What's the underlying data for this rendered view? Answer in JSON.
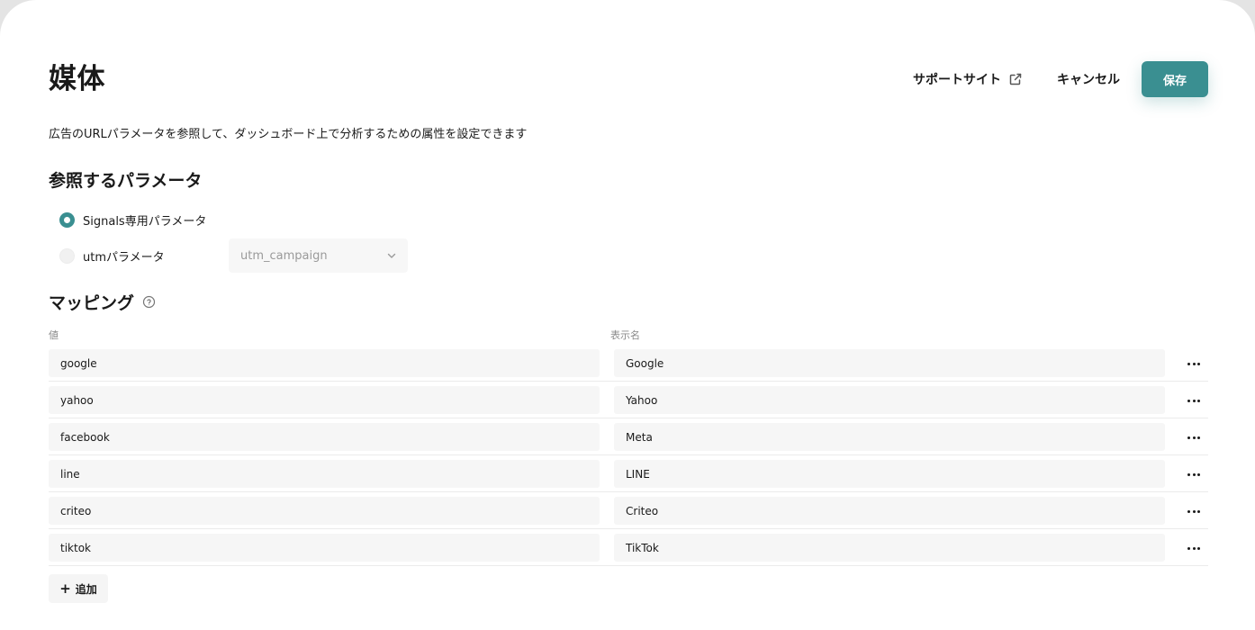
{
  "page": {
    "title": "媒体",
    "description": "広告のURLパラメータを参照して、ダッシュボード上で分析するための属性を設定できます"
  },
  "header": {
    "support_label": "サポートサイト",
    "support_icon": "external-link-icon",
    "cancel_label": "キャンセル",
    "save_label": "保存"
  },
  "params": {
    "title": "参照するパラメータ",
    "options": [
      {
        "label": "Signals専用パラメータ",
        "selected": true
      },
      {
        "label": "utmパラメータ",
        "selected": false
      }
    ],
    "select_value": "utm_campaign"
  },
  "mapping": {
    "title": "マッピング",
    "help_icon": "help-circle-icon",
    "columns": {
      "value": "値",
      "display": "表示名"
    },
    "rows": [
      {
        "value": "google",
        "display": "Google"
      },
      {
        "value": "yahoo",
        "display": "Yahoo"
      },
      {
        "value": "facebook",
        "display": "Meta"
      },
      {
        "value": "line",
        "display": "LINE"
      },
      {
        "value": "criteo",
        "display": "Criteo"
      },
      {
        "value": "tiktok",
        "display": "TikTok"
      }
    ],
    "add_label": "追加",
    "add_icon": "plus-icon"
  },
  "colors": {
    "accent": "#3a8f91",
    "input_bg": "#f6f6f6"
  }
}
